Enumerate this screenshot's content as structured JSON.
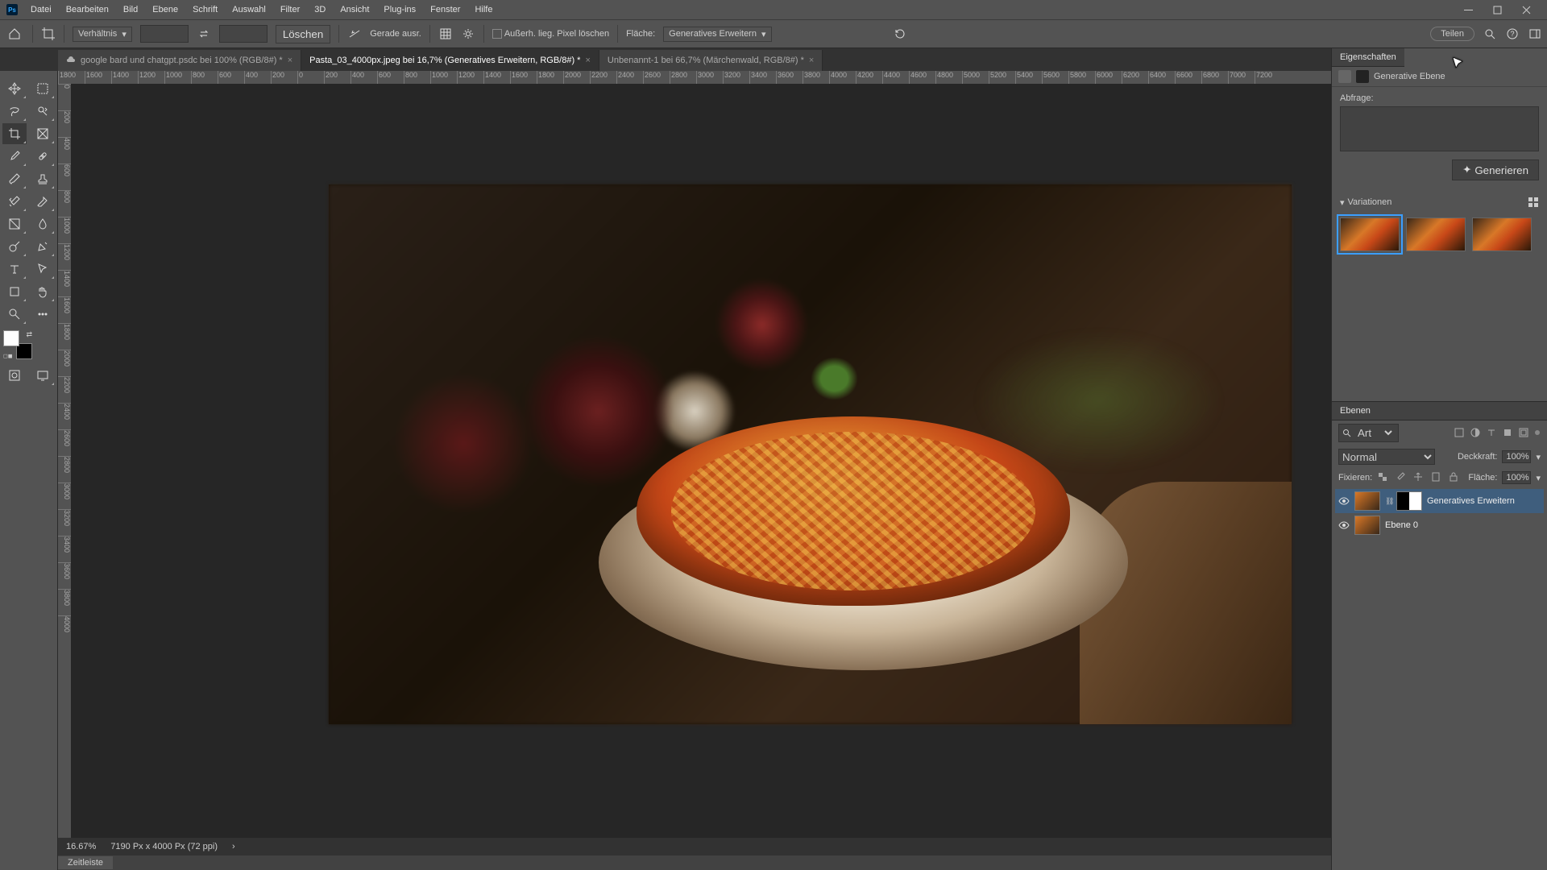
{
  "menu": {
    "items": [
      "Datei",
      "Bearbeiten",
      "Bild",
      "Ebene",
      "Schrift",
      "Auswahl",
      "Filter",
      "3D",
      "Ansicht",
      "Plug-ins",
      "Fenster",
      "Hilfe"
    ]
  },
  "optbar": {
    "ratio_label": "Verhältnis",
    "clear": "Löschen",
    "straighten": "Gerade ausr.",
    "delete_px": "Außerh. lieg. Pixel löschen",
    "fill_label": "Fläche:",
    "fill_value": "Generatives Erweitern",
    "share": "Teilen"
  },
  "tabs": [
    {
      "label": "google bard und chatgpt.psdc bei 100% (RGB/8#) *"
    },
    {
      "label": "Pasta_03_4000px.jpeg bei 16,7% (Generatives Erweitern, RGB/8#) *"
    },
    {
      "label": "Unbenannt-1 bei 66,7% (Märchenwald, RGB/8#) *"
    }
  ],
  "ruler_h": [
    "1800",
    "1600",
    "1400",
    "1200",
    "1000",
    "800",
    "600",
    "400",
    "200",
    "0",
    "200",
    "400",
    "600",
    "800",
    "1000",
    "1200",
    "1400",
    "1600",
    "1800",
    "2000",
    "2200",
    "2400",
    "2600",
    "2800",
    "3000",
    "3200",
    "3400",
    "3600",
    "3800",
    "4000",
    "4200",
    "4400",
    "4600",
    "4800",
    "5000",
    "5200",
    "5400",
    "5600",
    "5800",
    "6000",
    "6200",
    "6400",
    "6600",
    "6800",
    "7000",
    "7200"
  ],
  "ruler_v": [
    "0",
    "200",
    "400",
    "600",
    "800",
    "1000",
    "1200",
    "1400",
    "1600",
    "1800",
    "2000",
    "2200",
    "2400",
    "2600",
    "2800",
    "3000",
    "3200",
    "3400",
    "3600",
    "3800",
    "4000"
  ],
  "properties": {
    "panel_title": "Eigenschaften",
    "layer_type": "Generative Ebene",
    "prompt_label": "Abfrage:",
    "generate_btn": "Generieren",
    "variations_label": "Variationen"
  },
  "layers": {
    "panel_title": "Ebenen",
    "filter_mode": "Art",
    "blend_mode": "Normal",
    "opacity_label": "Deckkraft:",
    "opacity_value": "100%",
    "lock_label": "Fixieren:",
    "fill_label": "Fläche:",
    "fill_value": "100%",
    "items": [
      {
        "name": "Generatives Erweitern"
      },
      {
        "name": "Ebene 0"
      }
    ]
  },
  "status": {
    "zoom": "16.67%",
    "info": "7190 Px x 4000 Px (72 ppi)"
  },
  "timeline": {
    "label": "Zeitleiste"
  }
}
